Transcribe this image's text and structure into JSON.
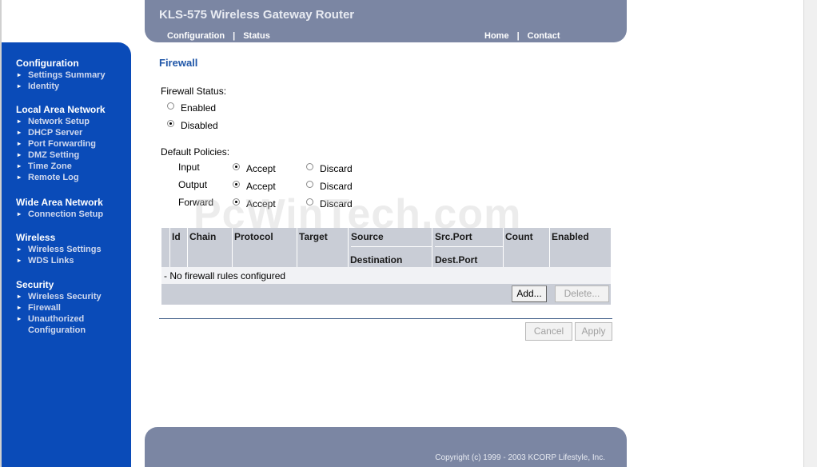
{
  "header": {
    "title": "KLS-575 Wireless Gateway Router",
    "nav_left": [
      "Configuration",
      "Status"
    ],
    "nav_right": [
      "Home",
      "Contact"
    ],
    "separator": "|"
  },
  "sidebar": {
    "groups": [
      {
        "title": "Configuration",
        "items": [
          "Settings Summary",
          "Identity"
        ]
      },
      {
        "title": "Local Area Network",
        "items": [
          "Network Setup",
          "DHCP Server",
          "Port Forwarding",
          "DMZ Setting",
          "Time Zone",
          "Remote Log"
        ]
      },
      {
        "title": "Wide Area Network",
        "items": [
          "Connection Setup"
        ]
      },
      {
        "title": "Wireless",
        "items": [
          "Wireless Settings",
          "WDS Links"
        ]
      },
      {
        "title": "Security",
        "items": [
          "Wireless Security",
          "Firewall",
          "Unauthorized",
          "Configuration"
        ]
      }
    ],
    "bullet": "▸"
  },
  "page": {
    "title": "Firewall",
    "firewall_status": {
      "label": "Firewall Status:",
      "options": [
        "Enabled",
        "Disabled"
      ],
      "selected": "Disabled"
    },
    "default_policies": {
      "label": "Default Policies:",
      "rows": [
        {
          "name": "Input",
          "accept": "Accept",
          "discard": "Discard",
          "selected": "Accept"
        },
        {
          "name": "Output",
          "accept": "Accept",
          "discard": "Discard",
          "selected": "Accept"
        },
        {
          "name": "Forward",
          "accept": "Accept",
          "discard": "Discard",
          "selected": "Accept"
        }
      ]
    },
    "rules_table": {
      "headers": [
        "Id",
        "Chain",
        "Protocol",
        "Target",
        "Source",
        "Src.Port",
        "Count",
        "Enabled"
      ],
      "sub_headers": {
        "source": "Destination",
        "src_port": "Dest.Port"
      },
      "empty_message": "- No firewall rules configured",
      "add_label": "Add...",
      "delete_label": "Delete..."
    },
    "cancel_label": "Cancel",
    "apply_label": "Apply"
  },
  "footer": {
    "copyright": "Copyright (c) 1999 - 2003 KCORP Lifestyle, Inc."
  },
  "watermark": "PcWinTech.com",
  "colors": {
    "header_bg": "#7b86a3",
    "sidebar_bg": "#0a4bb8",
    "title_blue": "#1f56a8",
    "table_header_bg": "#c9cdd6"
  }
}
